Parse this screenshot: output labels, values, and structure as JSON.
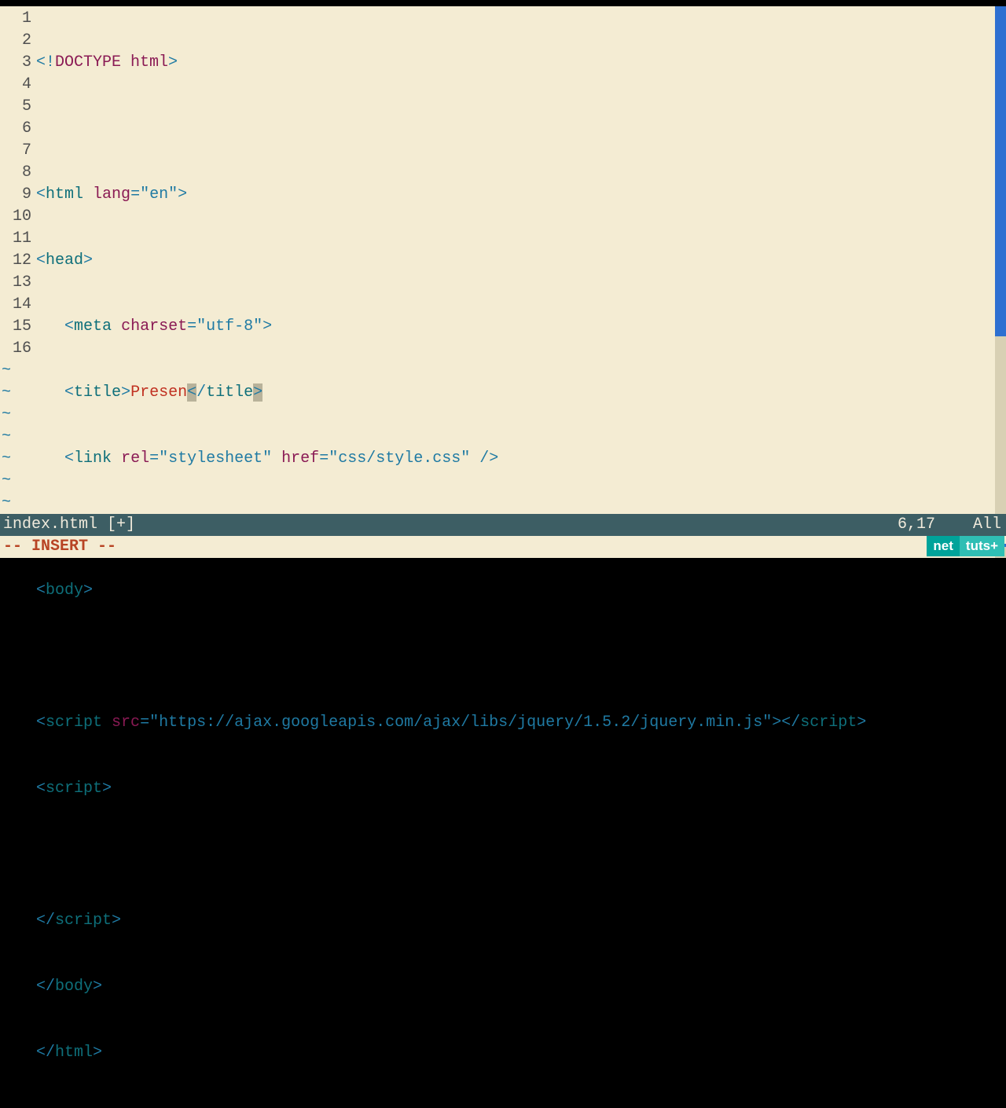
{
  "editor": {
    "filename": "index.html",
    "modified_flag": "[+]",
    "cursor_position": "6,17",
    "scroll_indicator": "All",
    "mode": "-- INSERT --",
    "line_numbers": [
      "1",
      "2",
      "3",
      "4",
      "5",
      "6",
      "7",
      "8",
      "9",
      "10",
      "11",
      "12",
      "13",
      "14",
      "15",
      "16"
    ],
    "tilde_count": 7,
    "title_text": "Presen",
    "link_rel": "stylesheet",
    "link_href": "css/style.css",
    "meta_charset": "utf-8",
    "html_lang": "en",
    "script_src": "https://ajax.googleapis.com/ajax/libs/jquery/1.5.2/jquery.min.js"
  },
  "logo": {
    "left": "net",
    "right": "tuts+"
  }
}
